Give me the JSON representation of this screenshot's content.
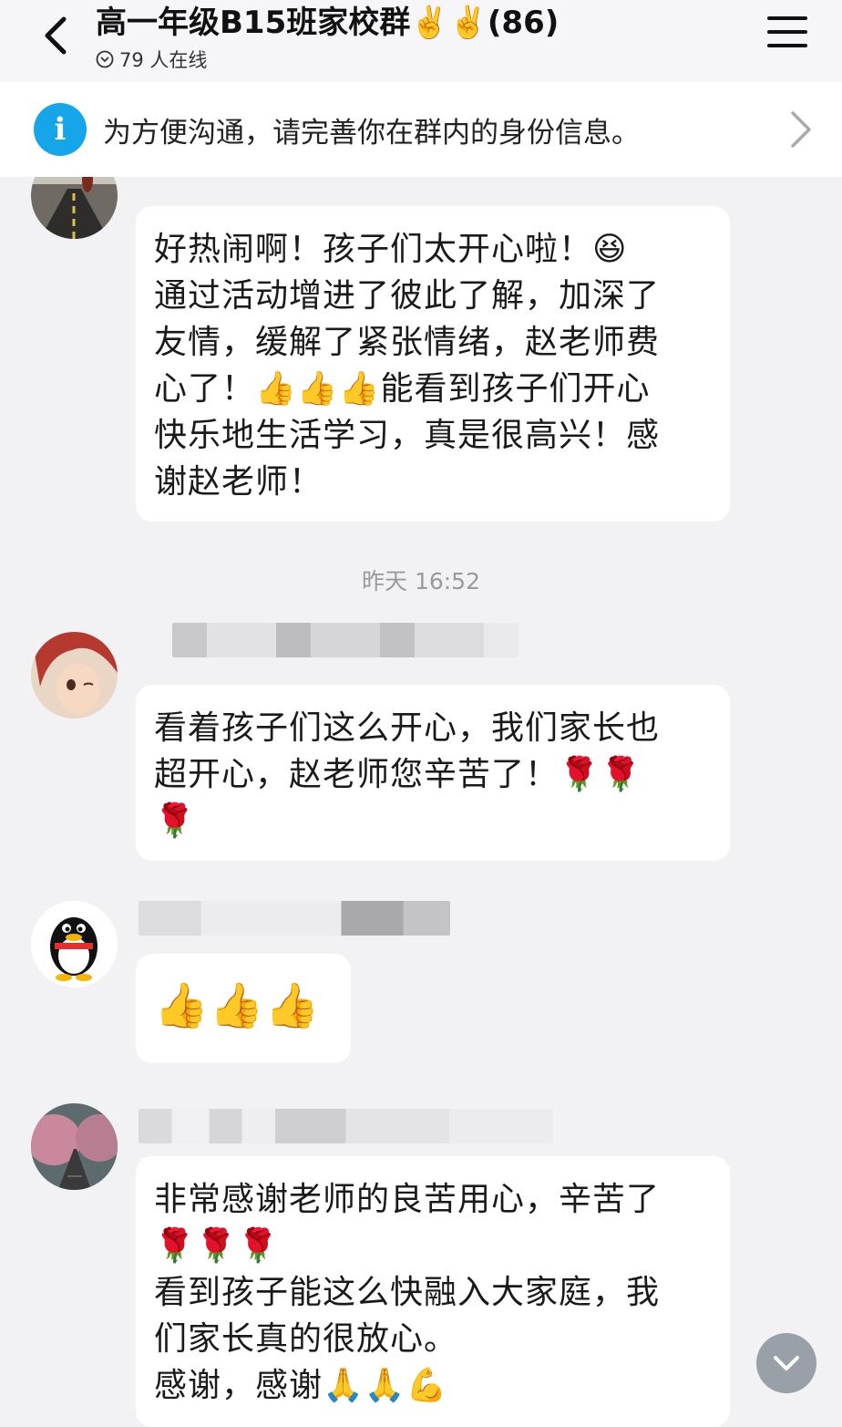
{
  "header": {
    "title": "高一年级B15班家校群✌️✌️(86)",
    "online": "79 人在线"
  },
  "notice": {
    "text": "为方便沟通，请完善你在群内的身份信息。"
  },
  "timestamp": "昨天 16:52",
  "messages": [
    {
      "text": "好热闹啊！孩子们太开心啦！😆\n通过活动增进了彼此了解，加深了\n友情，缓解了紧张情绪，赵老师费\n心了！👍👍👍能看到孩子们开心\n快乐地生活学习，真是很高兴！感\n谢赵老师！"
    },
    {
      "text": "看着孩子们这么开心，我们家长也\n超开心，赵老师您辛苦了！🌹🌹\n🌹"
    },
    {
      "text": "👍👍👍"
    },
    {
      "text": "非常感谢老师的良苦用心，辛苦了\n🌹🌹🌹\n看到孩子能这么快融入大家庭，我\n们家长真的很放心。\n感谢，感谢🙏🙏💪"
    }
  ],
  "colors": {
    "accent": "#15a6ea",
    "background": "#f2f2f4",
    "bubble": "#ffffff"
  }
}
